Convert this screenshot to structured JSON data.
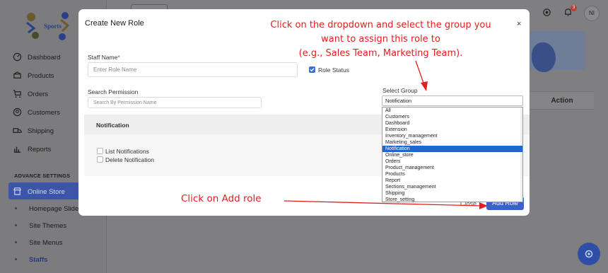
{
  "sidebar": {
    "logo_text": "Sports",
    "items": [
      {
        "label": "Dashboard",
        "icon": "gauge-icon"
      },
      {
        "label": "Products",
        "icon": "box-icon"
      },
      {
        "label": "Orders",
        "icon": "cart-icon"
      },
      {
        "label": "Customers",
        "icon": "user-icon"
      },
      {
        "label": "Shipping",
        "icon": "truck-icon"
      },
      {
        "label": "Reports",
        "icon": "chart-icon"
      }
    ],
    "section_label": "ADVANCE SETTINGS",
    "settings_items": [
      {
        "label": "Online Store",
        "icon": "store-icon",
        "active": true
      },
      {
        "label": "Homepage Sliders"
      },
      {
        "label": "Site Themes"
      },
      {
        "label": "Site Menus"
      },
      {
        "label": "Staffs",
        "current": true
      }
    ]
  },
  "topbar": {
    "notification_count": "3",
    "avatar_initials": "NI"
  },
  "table": {
    "action_header": "Action"
  },
  "modal": {
    "title": "Create New Role",
    "close_symbol": "×",
    "staff_name_label": "Staff Name",
    "required_mark": "*",
    "staff_name_placeholder": "Enter Role Name",
    "role_status_label": "Role Status",
    "search_permission_label": "Search Permission",
    "search_permission_placeholder": "Search By Permission Name",
    "select_group_label": "Select Group",
    "selected_group": "Notification",
    "group_options": [
      "All",
      "Customers",
      "Dashboard",
      "Extension",
      "Inventory_management",
      "Marketing_sales",
      "Notification",
      "Online_store",
      "Orders",
      "Product_management",
      "Products",
      "Report",
      "Sections_management",
      "Shipping",
      "Store_setting"
    ],
    "permission_group_title": "Notification",
    "permissions": [
      "List Notifications",
      "Delete Notification"
    ],
    "close_label": "Close",
    "add_role_label": "Add Role"
  },
  "annotations": {
    "select_group_hint_line1": "Click on the dropdown and select the group you",
    "select_group_hint_line2": "want to assign this role to",
    "select_group_hint_line3": "(e.g., Sales Team, Marketing Team).",
    "add_role_hint": "Click on Add role"
  },
  "colors": {
    "overlay": "#7f7f81",
    "accent": "#3b62c8",
    "annotation": "#e02020",
    "selected_option": "#1f66d1"
  }
}
